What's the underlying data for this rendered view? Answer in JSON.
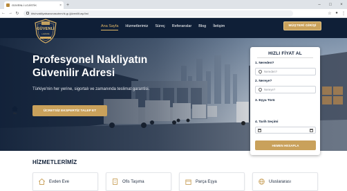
{
  "browser": {
    "tab_title": "GÜVENLİ LOJİSTİK",
    "url": "kfs/nvakllyatsavunasutnm/ık.gı.ğüvenlilt.aşı/lıst"
  },
  "brand": {
    "logo_text": "GÜVENLİ",
    "logo_sub": "LOJİSTİK",
    "accent": "#c9a15b",
    "navy": "#0f1f37"
  },
  "nav": {
    "items": [
      "Ana Sayfa",
      "Hizmetlerimiz",
      "Süreç",
      "Referanslar",
      "Blog",
      "İletişim"
    ],
    "cta": "MÜŞTERİ GİRİŞİ"
  },
  "hero": {
    "title_line1": "Profesyonel Nakliyatın",
    "title_line2": "Güvenilir Adresi",
    "subtitle": "Türkiye'nin her yerine, sigortalı ve zamanında teslimat garantisi.",
    "button": "ÜCRETSİZ EKSPERTİZ TALEP ET"
  },
  "quote": {
    "title": "HIZLI FİYAT AL",
    "from_label": "1. Nereden?",
    "from_placeholder": "Nereden?",
    "to_label": "2. Nereye?",
    "to_placeholder": "Nereye?",
    "type_label": "3. Eşya Türü",
    "types": [
      "Ev",
      "Ofis",
      "Depo"
    ],
    "date_label": "4. Tarih Seçimi",
    "button": "HEMEN HESAPLA"
  },
  "services": {
    "title": "HİZMETLERİMİZ",
    "items": [
      {
        "label": "Evden Eve",
        "icon": "house-icon"
      },
      {
        "label": "Ofis Taşıma",
        "icon": "office-icon"
      },
      {
        "label": "Parça Eşya",
        "icon": "box-icon"
      },
      {
        "label": "Uluslararası",
        "icon": "globe-icon"
      }
    ]
  }
}
